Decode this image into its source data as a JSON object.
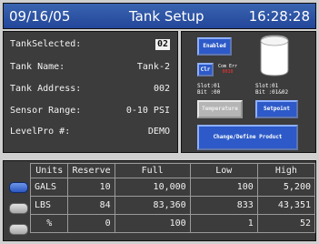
{
  "header": {
    "date": "09/16/05",
    "title": "Tank Setup",
    "time": "16:28:28"
  },
  "info": {
    "tank_selected_label": "TankSelected:",
    "tank_selected_value": "02",
    "tank_name_label": "Tank Name:",
    "tank_name_value": "Tank-2",
    "tank_address_label": "Tank Address:",
    "tank_address_value": "002",
    "sensor_range_label": "Sensor Range:",
    "sensor_range_value": "0-10 PSI",
    "levelpro_label": "LevelPro #:",
    "levelpro_value": "DEMO"
  },
  "controls": {
    "enabled_label": "Enabled",
    "clr_label": "Clr",
    "com_err_label": "Com Err",
    "com_err_code": "0010",
    "slot_a_line1": "Slot:01",
    "slot_a_line2": "Bit :00",
    "slot_b_line1": "Slot:01",
    "slot_b_line2": "Bit :01&02",
    "temperature_label": "Temperature",
    "setpoint_label": "Setpoint",
    "change_label": "Change/Define  Product"
  },
  "table": {
    "headers": [
      "Units",
      "Reserve",
      "Full",
      "Low",
      "High"
    ],
    "rows": [
      {
        "units": "GALS",
        "reserve": "10",
        "full": "10,000",
        "low": "100",
        "high": "5,200"
      },
      {
        "units": "LBS",
        "reserve": "84",
        "full": "83,360",
        "low": "833",
        "high": "43,351"
      },
      {
        "units": "%",
        "reserve": "0",
        "full": "100",
        "low": "1",
        "high": "52"
      }
    ]
  },
  "colors": {
    "header_bg": "#2d55a8",
    "panel_bg": "#3c3c3c",
    "button_blue": "#2d5ac8",
    "error_red": "#ff3030"
  },
  "icons": {
    "tank": "tank-icon",
    "unit_selector_active": "blue-pill-button",
    "unit_selector_inactive": "grey-pill-button"
  }
}
